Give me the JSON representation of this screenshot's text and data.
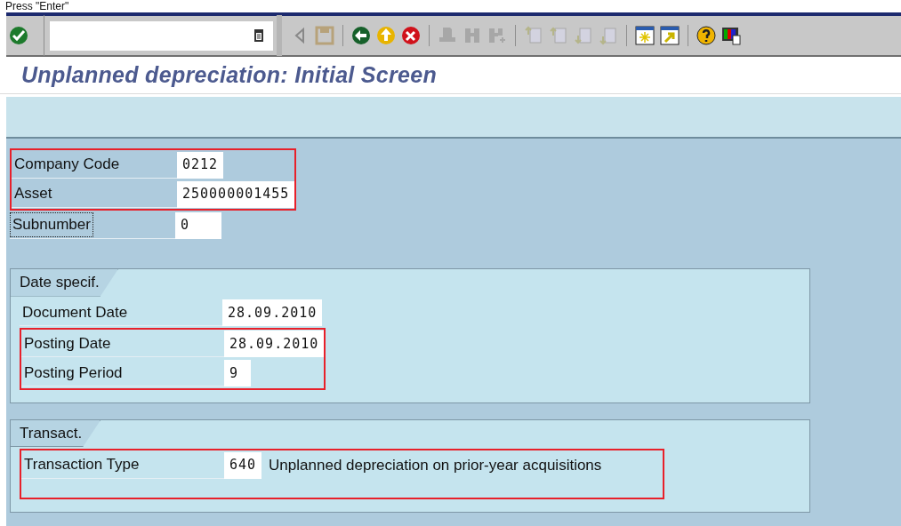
{
  "hint": "Press \"Enter\"",
  "title": "Unplanned depreciation: Initial Screen",
  "header_fields": [
    {
      "label": "Company Code",
      "value": "0212",
      "highlighted": true,
      "focused": false
    },
    {
      "label": "Asset",
      "value": "250000001455",
      "highlighted": true,
      "focused": false
    },
    {
      "label": "Subnumber",
      "value": "0",
      "highlighted": false,
      "focused": true
    }
  ],
  "groups": [
    {
      "title": "Date specif.",
      "fields": [
        {
          "label": "Document Date",
          "value": "28.09.2010",
          "highlighted": false
        },
        {
          "label": "Posting Date",
          "value": "28.09.2010",
          "highlighted": true
        },
        {
          "label": "Posting Period",
          "value": "9",
          "highlighted": true
        }
      ]
    },
    {
      "title": "Transact.",
      "fields": [
        {
          "label": "Transaction Type",
          "value": "640",
          "description": "Unplanned depreciation on prior-year acquisitions",
          "highlighted": true
        }
      ]
    }
  ]
}
